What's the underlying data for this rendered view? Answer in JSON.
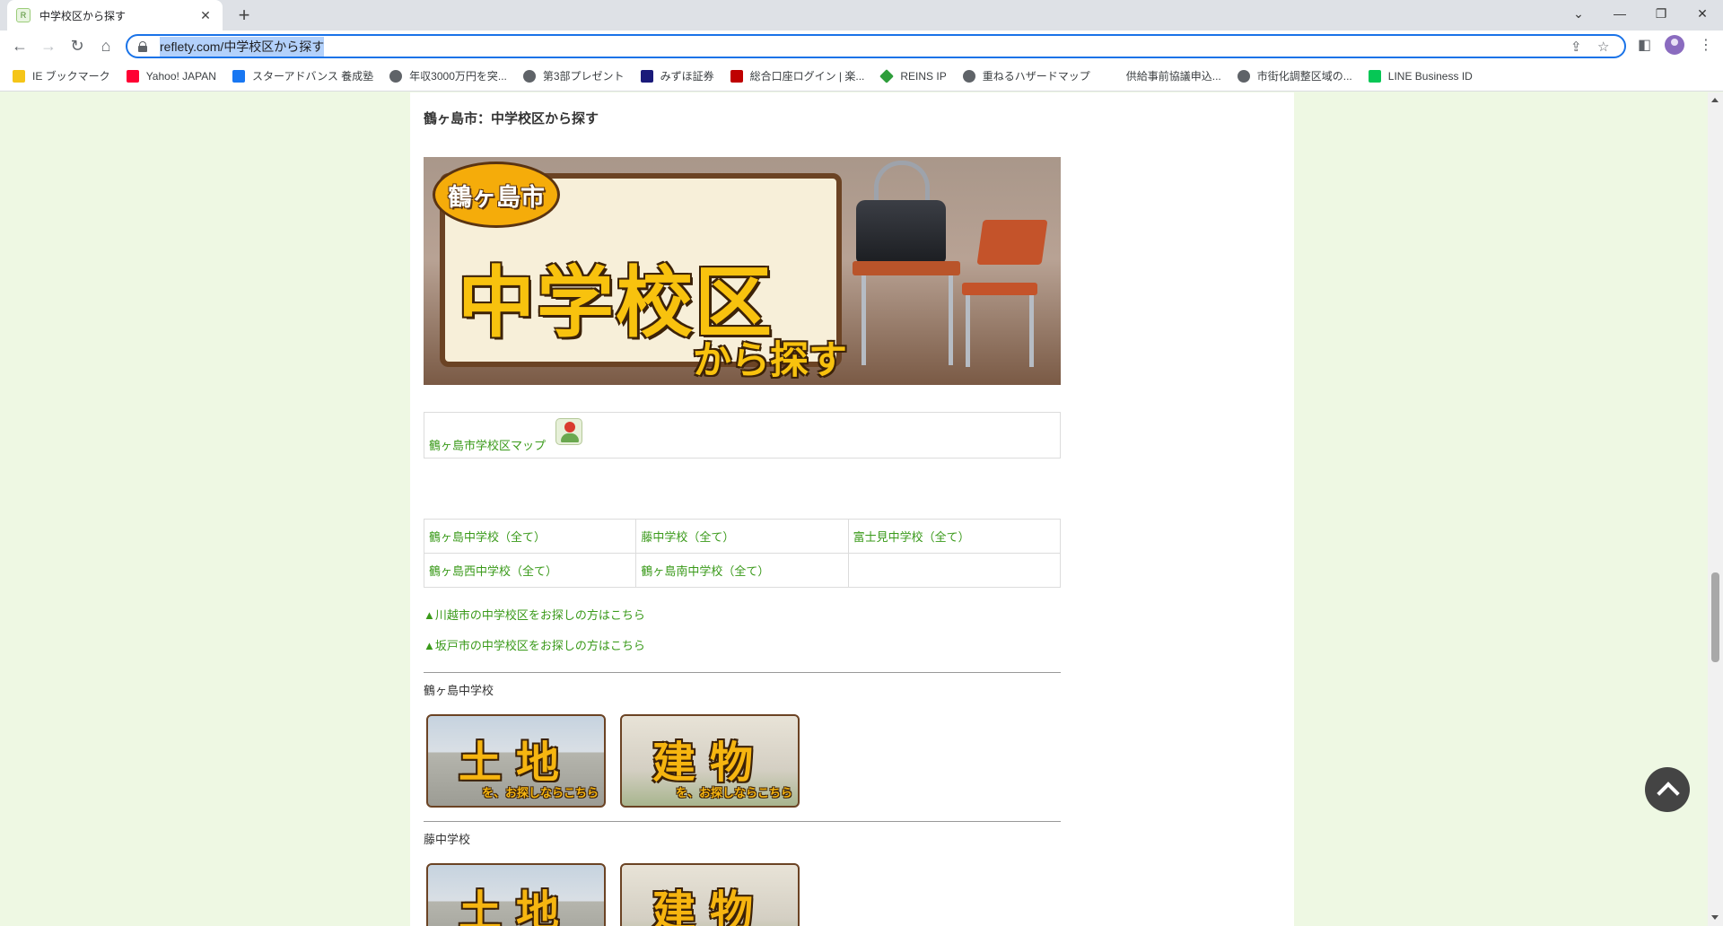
{
  "browser": {
    "tab_title": "中学校区から探す",
    "url": "reflety.com/中学校区から探す",
    "bookmarks": [
      {
        "label": "IE ブックマーク",
        "color": "#f5c518"
      },
      {
        "label": "Yahoo! JAPAN",
        "color": "#ff0033"
      },
      {
        "label": "スターアドバンス 養成塾",
        "color": "#1877f2"
      },
      {
        "label": "年収3000万円を突...",
        "color": "#5f6368"
      },
      {
        "label": "第3部プレゼント",
        "color": "#5f6368"
      },
      {
        "label": "みずほ証券",
        "color": "#1a1a7a"
      },
      {
        "label": "総合口座ログイン | 楽...",
        "color": "#bf0000"
      },
      {
        "label": "REINS IP",
        "color": "#2e9e3b"
      },
      {
        "label": "重ねるハザードマップ",
        "color": "#5f6368"
      },
      {
        "label": "供給事前協議申込...",
        "color": "#ffffff"
      },
      {
        "label": "市街化調整区域の...",
        "color": "#5f6368"
      },
      {
        "label": "LINE Business ID",
        "color": "#06c755"
      }
    ]
  },
  "page": {
    "heading": "鶴ヶ島市：中学校区から探す",
    "hero": {
      "badge": "鶴ヶ島市",
      "main": "中学校区",
      "sub": "から探す"
    },
    "map_link": "鶴ヶ島市学校区マップ",
    "schools": [
      [
        "鶴ヶ島中学校（全て）",
        "藤中学校（全て）",
        "富士見中学校（全て）"
      ],
      [
        "鶴ヶ島西中学校（全て）",
        "鶴ヶ島南中学校（全て）",
        ""
      ]
    ],
    "city_links": [
      "▲川越市の中学校区をお探しの方はこちら",
      "▲坂戸市の中学校区をお探しの方はこちら"
    ],
    "sections": [
      {
        "name": "鶴ヶ島中学校"
      },
      {
        "name": "藤中学校"
      }
    ],
    "banner_land": "土地",
    "banner_bldg": "建物",
    "banner_sub": "を、お探しならこちら"
  }
}
